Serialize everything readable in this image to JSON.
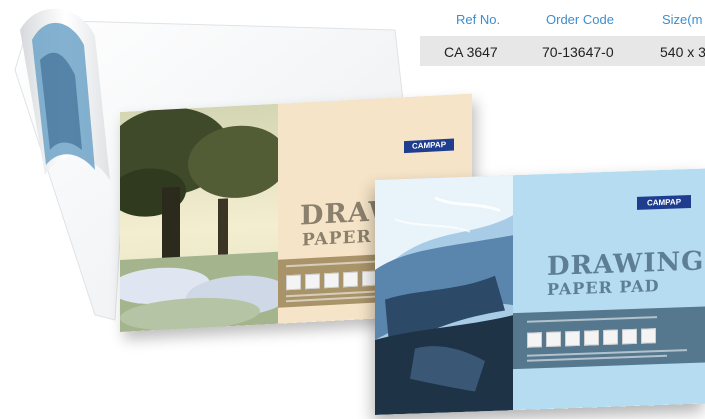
{
  "spec_table": {
    "headers": [
      "Ref No.",
      "Order Code",
      "Size(m"
    ],
    "row": [
      "CA 3647",
      "70-13647-0",
      "540 x 3"
    ]
  },
  "colors": {
    "header_text": "#3a8fcf",
    "row_bg": "#e7e7e7",
    "tree_cover": "#f6e4c8",
    "blue_cover": "#b5dcf0",
    "brand_blue": "#1f3d8f"
  },
  "pads": {
    "middle": {
      "brand": "CAMPAP",
      "title_line1": "DRAW",
      "title_line2": "PAPER P"
    },
    "front": {
      "brand": "CAMPAP",
      "title_line1": "DRAWING",
      "title_line2": "PAPER PAD"
    }
  }
}
